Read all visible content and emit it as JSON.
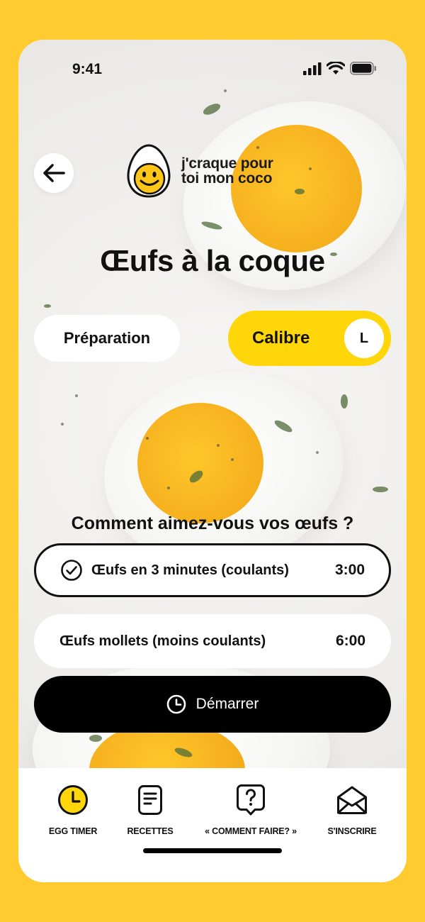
{
  "status_bar": {
    "time": "9:41"
  },
  "header": {
    "logo_line1": "j'craque pour",
    "logo_line2": "toi mon coco"
  },
  "page": {
    "title": "Œufs à la coque"
  },
  "tabs": {
    "preparation_label": "Préparation",
    "calibre_label": "Calibre",
    "calibre_value": "L"
  },
  "question": "Comment aimez-vous vos œufs ?",
  "options": [
    {
      "label": "Œufs en 3 minutes (coulants)",
      "time": "3:00",
      "selected": true
    },
    {
      "label": "Œufs mollets (moins coulants)",
      "time": "6:00",
      "selected": false
    }
  ],
  "start_button": {
    "label": "Démarrer"
  },
  "nav": [
    {
      "label": "EGG TIMER",
      "icon": "clock-icon",
      "active": true
    },
    {
      "label": "RECETTES",
      "icon": "document-icon"
    },
    {
      "label": "« COMMENT FAIRE? »",
      "icon": "question-bubble-icon"
    },
    {
      "label": "S'INSCRIRE",
      "icon": "envelope-icon"
    }
  ],
  "colors": {
    "background": "#FFCB2E",
    "accent": "#FFD60A",
    "button": "#000000",
    "text": "#111111"
  }
}
